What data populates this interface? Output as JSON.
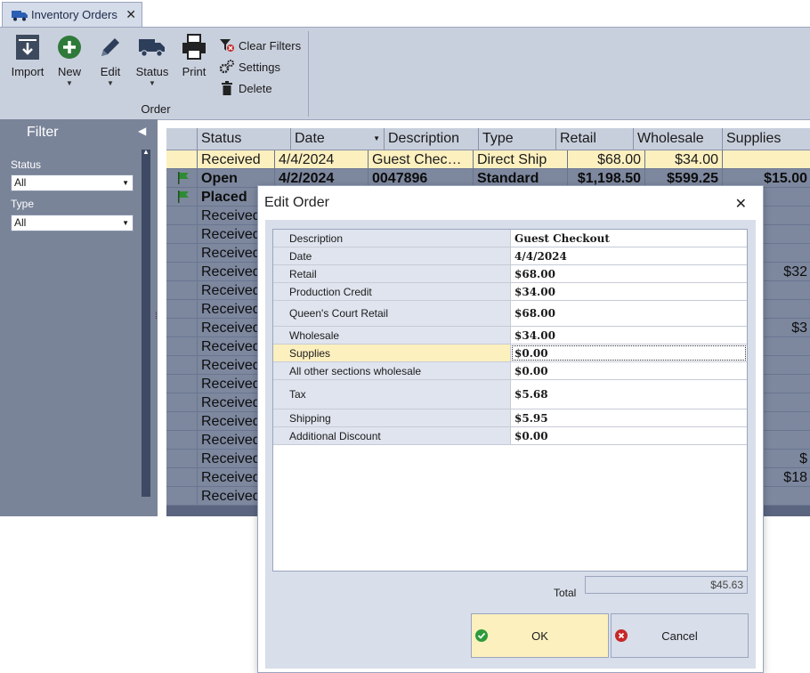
{
  "tab": {
    "title": "Inventory Orders",
    "close": "✕"
  },
  "ribbon": {
    "buttons": [
      {
        "label": "Import",
        "icon": "import-icon"
      },
      {
        "label": "New",
        "icon": "plus-circle-icon"
      },
      {
        "label": "Edit",
        "icon": "pencil-icon"
      },
      {
        "label": "Status",
        "icon": "truck-icon"
      },
      {
        "label": "Print",
        "icon": "printer-icon"
      }
    ],
    "small_buttons": [
      {
        "label": "Clear Filters",
        "icon": "clear-filter-icon"
      },
      {
        "label": "Settings",
        "icon": "gears-icon"
      },
      {
        "label": "Delete",
        "icon": "trash-icon"
      }
    ],
    "group_label": "Order"
  },
  "filter": {
    "title": "Filter",
    "status_label": "Status",
    "status_value": "All",
    "type_label": "Type",
    "type_value": "All"
  },
  "grid": {
    "columns": [
      "Status",
      "Date",
      "Description",
      "Type",
      "Retail",
      "Wholesale",
      "Supplies"
    ],
    "rows": [
      {
        "status": "Received",
        "date": "4/4/2024",
        "description": "Guest  Chec…",
        "type": "Direct Ship",
        "retail": "$68.00",
        "wholesale": "$34.00",
        "supplies": "",
        "selected": true
      },
      {
        "status": "Open",
        "date": "4/2/2024",
        "description": "0047896",
        "type": "Standard",
        "retail": "$1,198.50",
        "wholesale": "$599.25",
        "supplies": "$15.00",
        "flag": true,
        "bold": true
      },
      {
        "status": "Placed",
        "flag": true,
        "bold": true
      },
      {
        "status": "Received"
      },
      {
        "status": "Received"
      },
      {
        "status": "Received"
      },
      {
        "status": "Received",
        "supplies": "$32"
      },
      {
        "status": "Received"
      },
      {
        "status": "Received"
      },
      {
        "status": "Received",
        "supplies": "$3"
      },
      {
        "status": "Received"
      },
      {
        "status": "Received"
      },
      {
        "status": "Received"
      },
      {
        "status": "Received"
      },
      {
        "status": "Received"
      },
      {
        "status": "Received"
      },
      {
        "status": "Received",
        "supplies": "$"
      },
      {
        "status": "Received",
        "supplies": "$18"
      },
      {
        "status": "Received"
      }
    ]
  },
  "dialog": {
    "title": "Edit Order",
    "close": "✕",
    "fields": [
      {
        "name": "Description",
        "value": "Guest  Checkout"
      },
      {
        "name": "Date",
        "value": "4/4/2024"
      },
      {
        "name": "Retail",
        "value": "$68.00"
      },
      {
        "name": "Production Credit",
        "value": "$34.00"
      },
      {
        "name": "Queen's Court Retail",
        "value": "$68.00"
      },
      {
        "name": "Wholesale",
        "value": "$34.00"
      },
      {
        "name": "Supplies",
        "value": "$0.00",
        "selected": true
      },
      {
        "name": "All other sections wholesale",
        "value": "$0.00"
      },
      {
        "name": "Tax",
        "value": "$5.68"
      },
      {
        "name": "Shipping",
        "value": "$5.95"
      },
      {
        "name": "Additional Discount",
        "value": "$0.00"
      }
    ],
    "total_label": "Total",
    "total_value": "$45.63",
    "ok_label": "OK",
    "cancel_label": "Cancel"
  }
}
